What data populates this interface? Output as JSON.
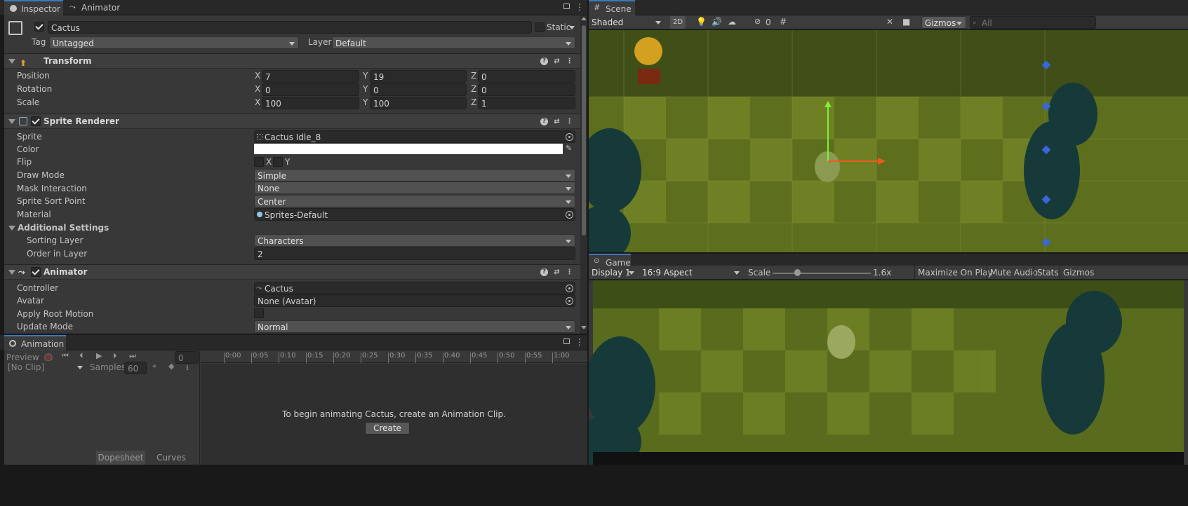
{
  "inspector": {
    "tabs": [
      {
        "label": "Inspector"
      },
      {
        "label": "Animator"
      }
    ],
    "object_name": "Cactus",
    "static_label": "Static",
    "tag_label": "Tag",
    "tag_value": "Untagged",
    "layer_label": "Layer",
    "layer_value": "Default",
    "transform": {
      "title": "Transform",
      "position": {
        "label": "Position",
        "x": "7",
        "y": "19",
        "z": "0"
      },
      "rotation": {
        "label": "Rotation",
        "x": "0",
        "y": "0",
        "z": "0"
      },
      "scale": {
        "label": "Scale",
        "x": "100",
        "y": "100",
        "z": "1"
      }
    },
    "axis": {
      "x": "X",
      "y": "Y",
      "z": "Z"
    },
    "sprite_renderer": {
      "title": "Sprite Renderer",
      "sprite_label": "Sprite",
      "sprite_value": "Cactus Idle_8",
      "color_label": "Color",
      "color_value": "#ffffff",
      "flip_label": "Flip",
      "flip_x": "X",
      "flip_y": "Y",
      "draw_mode_label": "Draw Mode",
      "draw_mode_value": "Simple",
      "mask_label": "Mask Interaction",
      "mask_value": "None",
      "sort_point_label": "Sprite Sort Point",
      "sort_point_value": "Center",
      "material_label": "Material",
      "material_value": "Sprites-Default",
      "additional_label": "Additional Settings",
      "sorting_layer_label": "Sorting Layer",
      "sorting_layer_value": "Characters",
      "order_label": "Order in Layer",
      "order_value": "2"
    },
    "animator": {
      "title": "Animator",
      "controller_label": "Controller",
      "controller_value": "Cactus",
      "avatar_label": "Avatar",
      "avatar_value": "None (Avatar)",
      "root_motion_label": "Apply Root Motion",
      "update_mode_label": "Update Mode",
      "update_mode_value": "Normal"
    }
  },
  "animation": {
    "tab_label": "Animation",
    "preview_label": "Preview",
    "frame_value": "0",
    "clip_value": "[No Clip]",
    "samples_label": "Samples",
    "samples_value": "60",
    "ticks": [
      "0:00",
      "0:05",
      "0:10",
      "0:15",
      "0:20",
      "0:25",
      "0:30",
      "0:35",
      "0:40",
      "0:45",
      "0:50",
      "0:55",
      "1:00"
    ],
    "message": "To begin animating Cactus, create an Animation Clip.",
    "create_label": "Create",
    "dopesheet_label": "Dopesheet",
    "curves_label": "Curves"
  },
  "scene": {
    "tab_label": "Scene",
    "shading_value": "Shaded",
    "mode_2d": "2D",
    "hidden_count": "0",
    "gizmos_label": "Gizmos",
    "search_placeholder": "All"
  },
  "game": {
    "tab_label": "Game",
    "display_value": "Display 1",
    "aspect_value": "16:9 Aspect",
    "scale_label": "Scale",
    "scale_value": "1.6x",
    "scale_fraction": 0.25,
    "maximize_label": "Maximize On Play",
    "mute_label": "Mute Audio",
    "stats_label": "Stats",
    "gizmos_label": "Gizmos"
  },
  "colors": {
    "accent": "#3a79bb",
    "panel": "#383838",
    "grass_dark": "#556b1d",
    "grass_light": "#7d8c2a"
  }
}
